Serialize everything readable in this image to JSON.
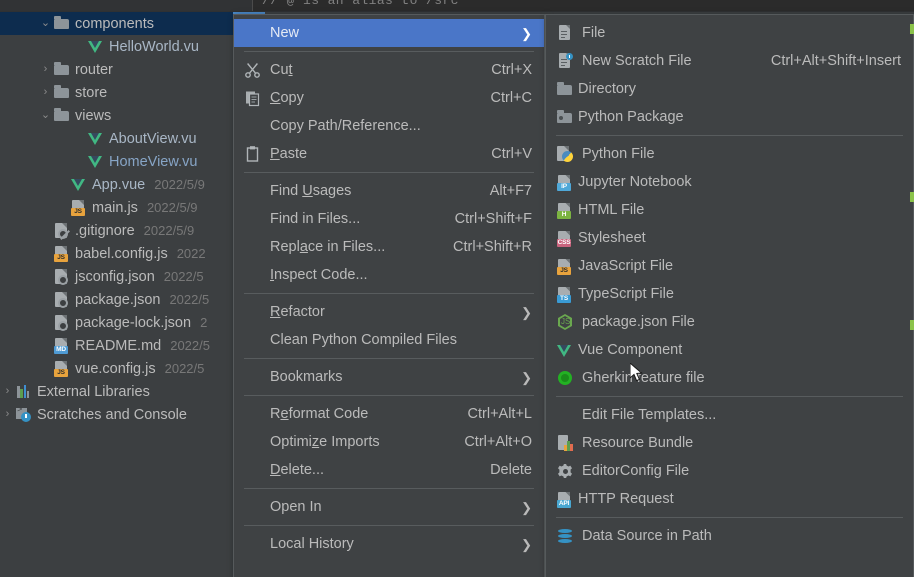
{
  "app": {
    "theme_bg": "#3c3f41",
    "menu_bg": "#3f4244",
    "accent_selected": "#4a76c8",
    "tree_selected_bg": "#0d2c4e",
    "text_color": "#bbbbbb"
  },
  "editor_strip": {
    "code_fragment": "// @ is an alias to /src"
  },
  "project_tree": {
    "items": [
      {
        "arrow": "v",
        "icon": "folder-icon",
        "label": "components",
        "timestamp": "",
        "selected": true,
        "indent": 56,
        "label_style": "node"
      },
      {
        "arrow": "",
        "icon": "vue-file-icon",
        "label": "HelloWorld.vu",
        "timestamp": "",
        "selected": false,
        "indent": 90,
        "label_style": "vuefile"
      },
      {
        "arrow": ">",
        "icon": "folder-icon",
        "label": "router",
        "timestamp": "",
        "selected": false,
        "indent": 56,
        "label_style": "node"
      },
      {
        "arrow": ">",
        "icon": "folder-icon",
        "label": "store",
        "timestamp": "",
        "selected": false,
        "indent": 56,
        "label_style": "node"
      },
      {
        "arrow": "v",
        "icon": "folder-icon",
        "label": "views",
        "timestamp": "",
        "selected": false,
        "indent": 56,
        "label_style": "node"
      },
      {
        "arrow": "",
        "icon": "vue-file-icon",
        "label": "AboutView.vu",
        "timestamp": "",
        "selected": false,
        "indent": 90,
        "label_style": "vuefile"
      },
      {
        "arrow": "",
        "icon": "vue-file-icon",
        "label": "HomeView.vu",
        "timestamp": "",
        "selected": false,
        "indent": 90,
        "label_style": "openfile"
      },
      {
        "arrow": "",
        "icon": "vue-file-icon",
        "label": "App.vue",
        "timestamp": "2022/5/9",
        "selected": false,
        "indent": 73,
        "label_style": "vuefile"
      },
      {
        "arrow": "",
        "icon": "js-file-icon",
        "label": "main.js",
        "timestamp": "2022/5/9",
        "selected": false,
        "indent": 73,
        "label_style": "node"
      },
      {
        "arrow": "",
        "icon": "gitignore-icon",
        "label": ".gitignore",
        "timestamp": "2022/5/9",
        "selected": false,
        "indent": 56,
        "label_style": "node"
      },
      {
        "arrow": "",
        "icon": "js-file-icon",
        "label": "babel.config.js",
        "timestamp": "2022",
        "selected": false,
        "indent": 56,
        "label_style": "node"
      },
      {
        "arrow": "",
        "icon": "json-file-icon",
        "label": "jsconfig.json",
        "timestamp": "2022/5",
        "selected": false,
        "indent": 56,
        "label_style": "node"
      },
      {
        "arrow": "",
        "icon": "json-file-icon",
        "label": "package.json",
        "timestamp": "2022/5",
        "selected": false,
        "indent": 56,
        "label_style": "node"
      },
      {
        "arrow": "",
        "icon": "json-file-icon",
        "label": "package-lock.json",
        "timestamp": "2",
        "selected": false,
        "indent": 56,
        "label_style": "node"
      },
      {
        "arrow": "",
        "icon": "md-file-icon",
        "label": "README.md",
        "timestamp": "2022/5",
        "selected": false,
        "indent": 56,
        "label_style": "node"
      },
      {
        "arrow": "",
        "icon": "js-file-icon",
        "label": "vue.config.js",
        "timestamp": "2022/5",
        "selected": false,
        "indent": 56,
        "label_style": "node"
      },
      {
        "arrow": ">",
        "icon": "external-libraries-icon",
        "label": "External Libraries",
        "timestamp": "",
        "selected": false,
        "indent": 8,
        "label_style": "node"
      },
      {
        "arrow": ">",
        "icon": "scratches-icon",
        "label": "Scratches and Console",
        "timestamp": "",
        "selected": false,
        "indent": 8,
        "label_style": "node"
      }
    ]
  },
  "context_menu": {
    "items": [
      {
        "kind": "item",
        "name": "new",
        "label": "New",
        "underline": "",
        "accel": "",
        "submenu": true,
        "icon": "",
        "selected": true
      },
      {
        "kind": "sep"
      },
      {
        "kind": "item",
        "name": "cut",
        "label": "Cut",
        "underline": "t",
        "accel": "Ctrl+X",
        "submenu": false,
        "icon": "scissors-icon"
      },
      {
        "kind": "item",
        "name": "copy",
        "label": "Copy",
        "underline": "C",
        "accel": "Ctrl+C",
        "submenu": false,
        "icon": "copy-icon"
      },
      {
        "kind": "item",
        "name": "copy-path-reference",
        "label": "Copy Path/Reference...",
        "underline": "",
        "accel": "",
        "submenu": false,
        "icon": ""
      },
      {
        "kind": "item",
        "name": "paste",
        "label": "Paste",
        "underline": "P",
        "accel": "Ctrl+V",
        "submenu": false,
        "icon": "clipboard-icon"
      },
      {
        "kind": "sep"
      },
      {
        "kind": "item",
        "name": "find-usages",
        "label": "Find Usages",
        "underline": "U",
        "accel": "Alt+F7",
        "submenu": false,
        "icon": ""
      },
      {
        "kind": "item",
        "name": "find-in-files",
        "label": "Find in Files...",
        "underline": "",
        "accel": "Ctrl+Shift+F",
        "submenu": false,
        "icon": ""
      },
      {
        "kind": "item",
        "name": "replace-in-files",
        "label": "Replace in Files...",
        "underline": "a",
        "accel": "Ctrl+Shift+R",
        "submenu": false,
        "icon": ""
      },
      {
        "kind": "item",
        "name": "inspect-code",
        "label": "Inspect Code...",
        "underline": "I",
        "accel": "",
        "submenu": false,
        "icon": ""
      },
      {
        "kind": "sep"
      },
      {
        "kind": "item",
        "name": "refactor",
        "label": "Refactor",
        "underline": "R",
        "accel": "",
        "submenu": true,
        "icon": ""
      },
      {
        "kind": "item",
        "name": "clean-python-compiled-files",
        "label": "Clean Python Compiled Files",
        "underline": "",
        "accel": "",
        "submenu": false,
        "icon": ""
      },
      {
        "kind": "sep"
      },
      {
        "kind": "item",
        "name": "bookmarks",
        "label": "Bookmarks",
        "underline": "",
        "accel": "",
        "submenu": true,
        "icon": ""
      },
      {
        "kind": "sep"
      },
      {
        "kind": "item",
        "name": "reformat-code",
        "label": "Reformat Code",
        "underline": "e",
        "accel": "Ctrl+Alt+L",
        "submenu": false,
        "icon": ""
      },
      {
        "kind": "item",
        "name": "optimize-imports",
        "label": "Optimize Imports",
        "underline": "z",
        "accel": "Ctrl+Alt+O",
        "submenu": false,
        "icon": ""
      },
      {
        "kind": "item",
        "name": "delete",
        "label": "Delete...",
        "underline": "D",
        "accel": "Delete",
        "submenu": false,
        "icon": ""
      },
      {
        "kind": "sep"
      },
      {
        "kind": "item",
        "name": "open-in",
        "label": "Open In",
        "underline": "",
        "accel": "",
        "submenu": true,
        "icon": ""
      },
      {
        "kind": "sep"
      },
      {
        "kind": "item",
        "name": "local-history",
        "label": "Local History",
        "underline": "",
        "accel": "",
        "submenu": true,
        "icon": ""
      }
    ]
  },
  "new_submenu": {
    "items": [
      {
        "kind": "item",
        "name": "file",
        "label": "File",
        "accel": "",
        "icon": "file-icon"
      },
      {
        "kind": "item",
        "name": "new-scratch-file",
        "label": "New Scratch File",
        "accel": "Ctrl+Alt+Shift+Insert",
        "icon": "scratch-file-icon"
      },
      {
        "kind": "item",
        "name": "directory",
        "label": "Directory",
        "accel": "",
        "icon": "folder-icon"
      },
      {
        "kind": "item",
        "name": "python-package",
        "label": "Python Package",
        "accel": "",
        "icon": "python-package-icon"
      },
      {
        "kind": "sep"
      },
      {
        "kind": "item",
        "name": "python-file",
        "label": "Python File",
        "accel": "",
        "icon": "python-file-icon"
      },
      {
        "kind": "item",
        "name": "jupyter-notebook",
        "label": "Jupyter Notebook",
        "accel": "",
        "icon": "jupyter-notebook-icon"
      },
      {
        "kind": "item",
        "name": "html-file",
        "label": "HTML File",
        "accel": "",
        "icon": "html-file-icon"
      },
      {
        "kind": "item",
        "name": "stylesheet",
        "label": "Stylesheet",
        "accel": "",
        "icon": "css-file-icon"
      },
      {
        "kind": "item",
        "name": "javascript-file",
        "label": "JavaScript File",
        "accel": "",
        "icon": "js-file-icon"
      },
      {
        "kind": "item",
        "name": "typescript-file",
        "label": "TypeScript File",
        "accel": "",
        "icon": "ts-file-icon"
      },
      {
        "kind": "item",
        "name": "package-json-file",
        "label": "package.json File",
        "accel": "",
        "icon": "node-json-icon"
      },
      {
        "kind": "item",
        "name": "vue-component",
        "label": "Vue Component",
        "accel": "",
        "icon": "vue-file-icon"
      },
      {
        "kind": "item",
        "name": "gherkin-feature-file",
        "label": "Gherkin feature file",
        "accel": "",
        "icon": "cucumber-icon"
      },
      {
        "kind": "sep"
      },
      {
        "kind": "item",
        "name": "edit-file-templates",
        "label": "Edit File Templates...",
        "accel": "",
        "icon": ""
      },
      {
        "kind": "item",
        "name": "resource-bundle",
        "label": "Resource Bundle",
        "accel": "",
        "icon": "resource-bundle-icon"
      },
      {
        "kind": "item",
        "name": "editorconfig-file",
        "label": "EditorConfig File",
        "accel": "",
        "icon": "gear-icon"
      },
      {
        "kind": "item",
        "name": "http-request",
        "label": "HTTP Request",
        "accel": "",
        "icon": "http-request-icon"
      },
      {
        "kind": "sep"
      },
      {
        "kind": "item",
        "name": "data-source-in-path",
        "label": "Data Source in Path",
        "accel": "",
        "icon": "database-icon"
      }
    ]
  }
}
